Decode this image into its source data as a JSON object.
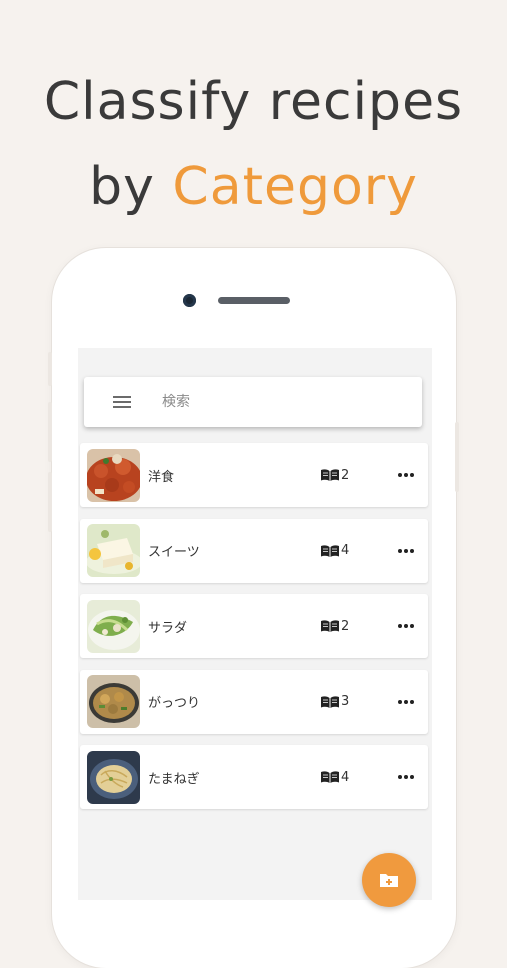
{
  "headline": {
    "line1": "Classify recipes",
    "line2_prefix": "by ",
    "line2_accent": "Category"
  },
  "colors": {
    "background": "#f6f2ee",
    "accent": "#ef9a3b",
    "fab": "#f09a3e"
  },
  "search": {
    "placeholder": "検索",
    "menu_icon": "hamburger-menu-icon"
  },
  "categories": [
    {
      "name": "洋食",
      "count": "2",
      "thumb": "tomato-stew"
    },
    {
      "name": "スイーツ",
      "count": "4",
      "thumb": "cheesecake"
    },
    {
      "name": "サラダ",
      "count": "2",
      "thumb": "green-salad"
    },
    {
      "name": "がっつり",
      "count": "3",
      "thumb": "stir-fry"
    },
    {
      "name": "たまねぎ",
      "count": "4",
      "thumb": "onion-dish"
    }
  ],
  "fab": {
    "icon": "add-folder-icon"
  }
}
